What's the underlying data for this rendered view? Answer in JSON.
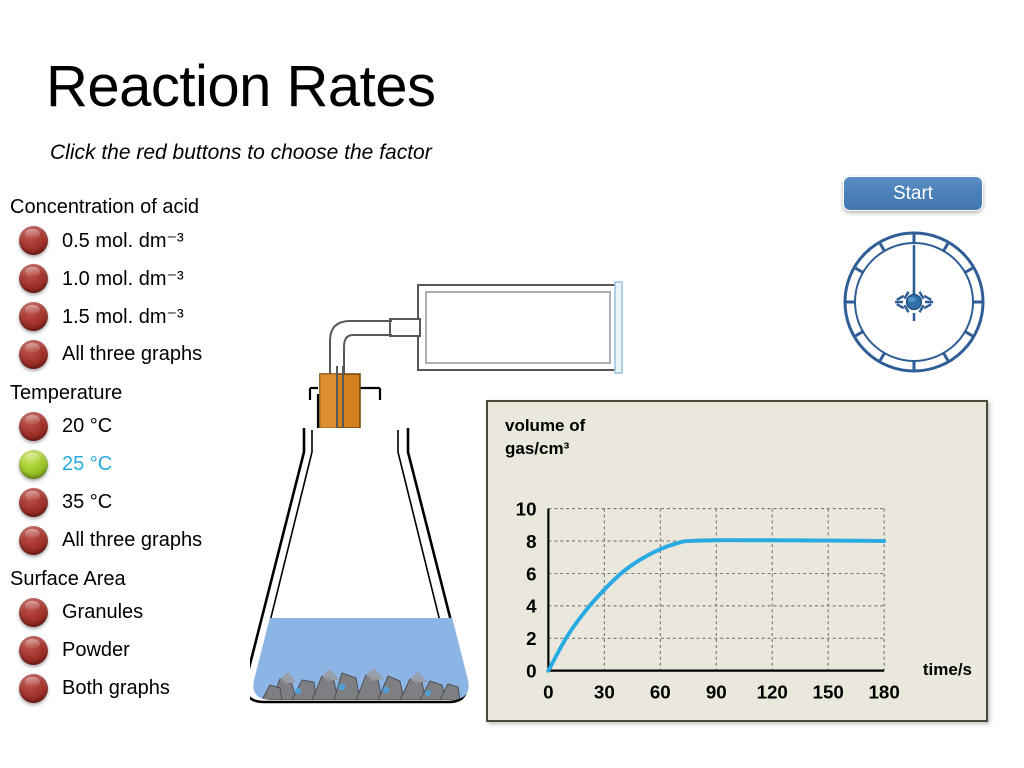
{
  "header": {
    "title": "Reaction Rates",
    "subtitle": "Click the red buttons to choose the factor"
  },
  "controls": {
    "start_label": "Start",
    "start_color": "#4a7fb8",
    "led_red": "#a93b33",
    "led_green": "#a8cf33",
    "highlight_color": "#29ABE2"
  },
  "stopwatch": {
    "needle_angle_deg": 0,
    "tick_count": 12
  },
  "groups": [
    {
      "heading": "Concentration of acid",
      "options": [
        {
          "label": "0.5 mol. dm⁻³",
          "selected": false
        },
        {
          "label": "1.0 mol. dm⁻³",
          "selected": false
        },
        {
          "label": "1.5 mol. dm⁻³",
          "selected": false
        },
        {
          "label": "All three graphs",
          "selected": false
        }
      ]
    },
    {
      "heading": "Temperature",
      "options": [
        {
          "label": "20  °C",
          "selected": false
        },
        {
          "label": "25  °C",
          "selected": true
        },
        {
          "label": "35  °C",
          "selected": false
        },
        {
          "label": "All three graphs",
          "selected": false
        }
      ]
    },
    {
      "heading": "Surface Area",
      "options": [
        {
          "label": "Granules",
          "selected": false
        },
        {
          "label": "Powder",
          "selected": false
        },
        {
          "label": "Both graphs",
          "selected": false
        }
      ]
    }
  ],
  "apparatus": {
    "flask_liquid_color": "#8CB4E4",
    "bung_color": "#D2811E",
    "granule_color": "#7d7f83",
    "syringe_label": "gas-syringe",
    "flask_label": "conical-flask"
  },
  "chart_data": {
    "type": "line",
    "title": "",
    "ylabel": "volume of\ngas/cm³",
    "xlabel": "time/s",
    "xlim": [
      0,
      180
    ],
    "ylim": [
      0,
      10
    ],
    "xticks": [
      0,
      30,
      60,
      90,
      120,
      150,
      180
    ],
    "yticks": [
      0,
      2,
      4,
      6,
      8,
      10
    ],
    "grid": true,
    "legend_position": "none",
    "line_color": "#29ABE2",
    "background_color": "#EAE8DC",
    "series": [
      {
        "name": "25 °C",
        "x": [
          0,
          10,
          20,
          30,
          40,
          50,
          60,
          70,
          75,
          90,
          105,
          120,
          135,
          150,
          165,
          180
        ],
        "y": [
          0,
          2.1,
          3.7,
          5.0,
          6.1,
          6.9,
          7.5,
          7.9,
          8.0,
          8.05,
          8.05,
          8.05,
          8.04,
          8.03,
          8.02,
          8.0
        ]
      }
    ]
  }
}
